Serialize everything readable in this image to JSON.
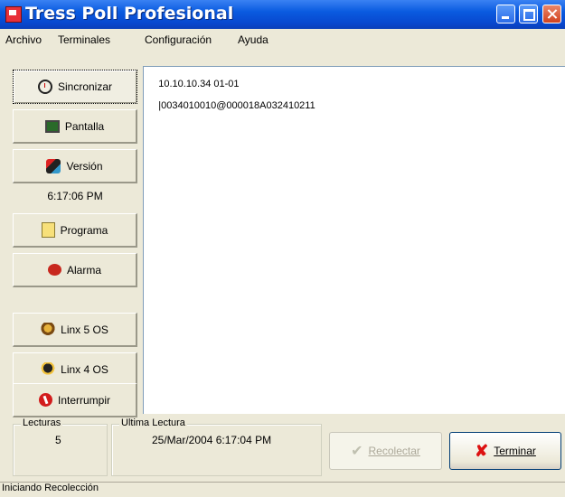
{
  "window": {
    "title": "Tress Poll Profesional"
  },
  "menu": [
    "Archivo",
    "Terminales",
    "Configuración",
    "Ayuda"
  ],
  "sidebar": {
    "sincronizar": "Sincronizar",
    "pantalla": "Pantalla",
    "version": "Versión",
    "time": "6:17:06 PM",
    "programa": "Programa",
    "alarma": "Alarma",
    "linx5": "Linx 5 OS",
    "linx4": "Linx 4 OS",
    "interrumpir": "Interrumpir"
  },
  "log": {
    "line_address": "10.10.10.34 01-01",
    "line_data": "|0034010010@000018A032410211"
  },
  "footer": {
    "lecturas_label": "Lecturas",
    "lecturas_value": "5",
    "ultima_label": "Ultima Lectura",
    "ultima_value": "25/Mar/2004 6:17:04 PM",
    "recolectar": "Recolectar",
    "terminar": "Terminar"
  },
  "status": "Iniciando Recolección"
}
